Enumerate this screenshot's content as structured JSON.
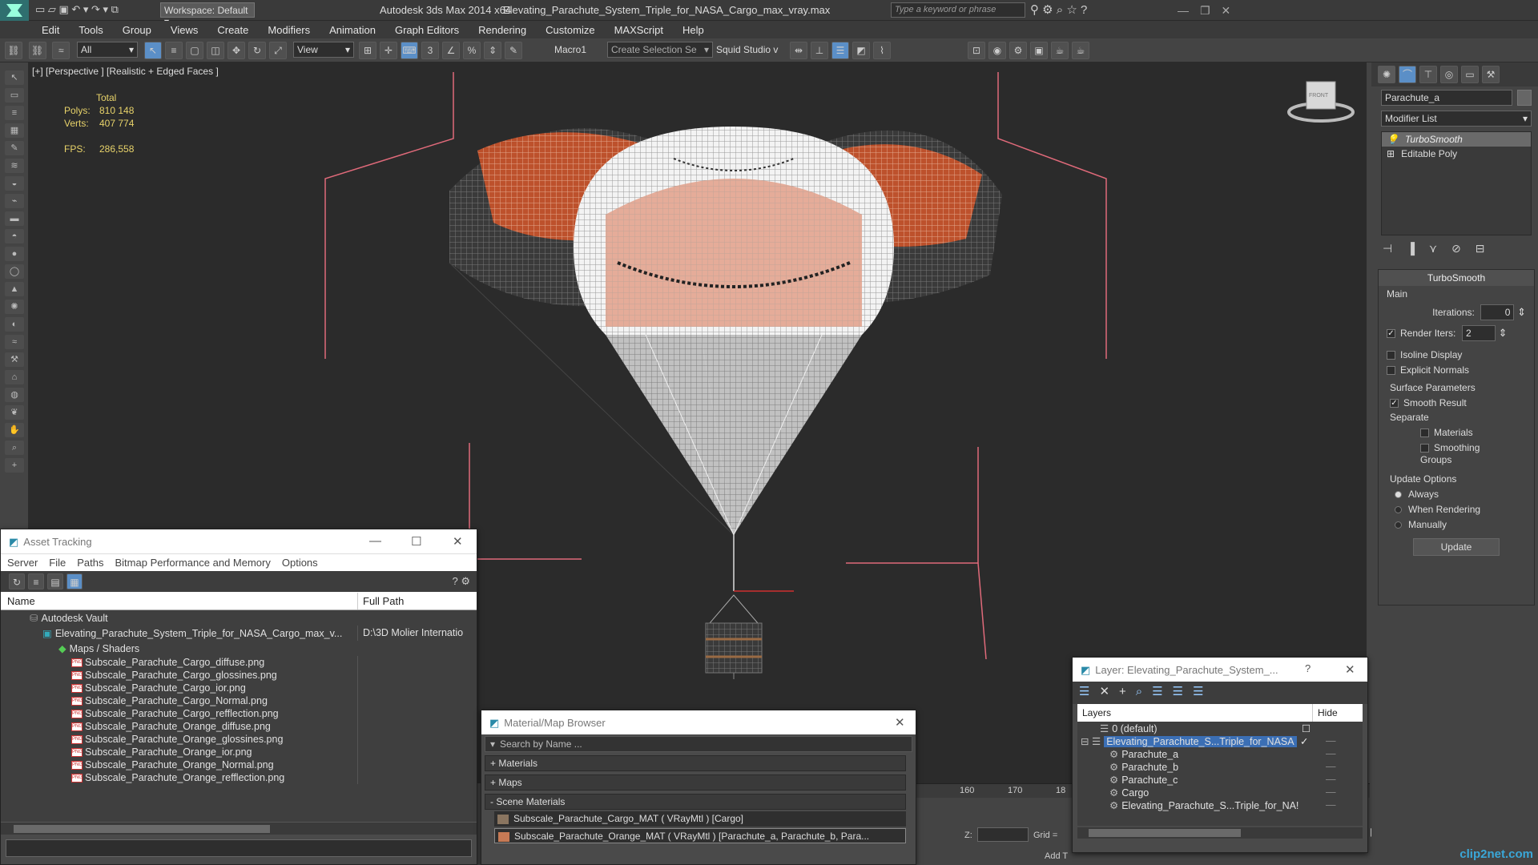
{
  "title": {
    "workspace": "Workspace: Default",
    "app": "Autodesk 3ds Max  2014 x64",
    "file": "Elevating_Parachute_System_Triple_for_NASA_Cargo_max_vray.max",
    "search_placeholder": "Type a keyword or phrase"
  },
  "menu": [
    "Edit",
    "Tools",
    "Group",
    "Views",
    "Create",
    "Modifiers",
    "Animation",
    "Graph Editors",
    "Rendering",
    "Customize",
    "MAXScript",
    "Help"
  ],
  "toolbar": {
    "filter": "All",
    "refcoord": "View",
    "macro": "Macro1",
    "selection_set": "Create Selection Se",
    "squid": "Squid Studio v"
  },
  "viewport": {
    "label": "[+] [Perspective ] [Realistic + Edged Faces ]",
    "stats_total": "Total",
    "polys_label": "Polys:",
    "polys_value": "810 148",
    "verts_label": "Verts:",
    "verts_value": "407 774",
    "fps_label": "FPS:",
    "fps_value": "286,558",
    "viewcube_label": "FRONT"
  },
  "cmdpanel": {
    "object_name": "Parachute_a",
    "modifier_list": "Modifier List",
    "stack": [
      "TurboSmooth",
      "Editable Poly"
    ],
    "turbosmooth_title": "TurboSmooth",
    "main_label": "Main",
    "iterations_label": "Iterations:",
    "iterations_value": "0",
    "render_iters_label": "Render Iters:",
    "render_iters_value": "2",
    "isoline": "Isoline Display",
    "explicit_normals": "Explicit Normals",
    "surface_params": "Surface Parameters",
    "smooth_result": "Smooth Result",
    "separate": "Separate",
    "materials": "Materials",
    "smoothing_groups": "Smoothing Groups",
    "update_options": "Update Options",
    "always": "Always",
    "when_rendering": "When Rendering",
    "manually": "Manually",
    "update_btn": "Update"
  },
  "asset_tracking": {
    "title": "Asset Tracking",
    "menu": [
      "Server",
      "File",
      "Paths",
      "Bitmap Performance and Memory",
      "Options"
    ],
    "col_name": "Name",
    "col_path": "Full Path",
    "vault": "Autodesk Vault",
    "file": "Elevating_Parachute_System_Triple_for_NASA_Cargo_max_v...",
    "file_path": "D:\\3D Molier Internatio",
    "maps": "Maps / Shaders",
    "files": [
      "Subscale_Parachute_Cargo_diffuse.png",
      "Subscale_Parachute_Cargo_glossines.png",
      "Subscale_Parachute_Cargo_ior.png",
      "Subscale_Parachute_Cargo_Normal.png",
      "Subscale_Parachute_Cargo_refflection.png",
      "Subscale_Parachute_Orange_diffuse.png",
      "Subscale_Parachute_Orange_glossines.png",
      "Subscale_Parachute_Orange_ior.png",
      "Subscale_Parachute_Orange_Normal.png",
      "Subscale_Parachute_Orange_refflection.png"
    ]
  },
  "material_browser": {
    "title": "Material/Map Browser",
    "search_placeholder": "Search by Name ...",
    "materials": "+ Materials",
    "maps": "+ Maps",
    "scene_materials": "- Scene Materials",
    "items": [
      "Subscale_Parachute_Cargo_MAT  ( VRayMtl )  [Cargo]",
      "Subscale_Parachute_Orange_MAT  ( VRayMtl )  [Parachute_a, Parachute_b, Para..."
    ]
  },
  "layer_window": {
    "title": "Layer: Elevating_Parachute_System_...",
    "help": "?",
    "col_layers": "Layers",
    "col_hide": "Hide",
    "rows": [
      "0 (default)",
      "Elevating_Parachute_S...Triple_for_NASA",
      "Parachute_a",
      "Parachute_b",
      "Parachute_c",
      "Cargo",
      "Elevating_Parachute_S...Triple_for_NA!"
    ]
  },
  "timeline": {
    "ticks": [
      "160",
      "170",
      "18"
    ],
    "z_label": "Z:",
    "grid_label": "Grid =",
    "add_t": "Add T"
  },
  "watermark": "clip2net.com"
}
